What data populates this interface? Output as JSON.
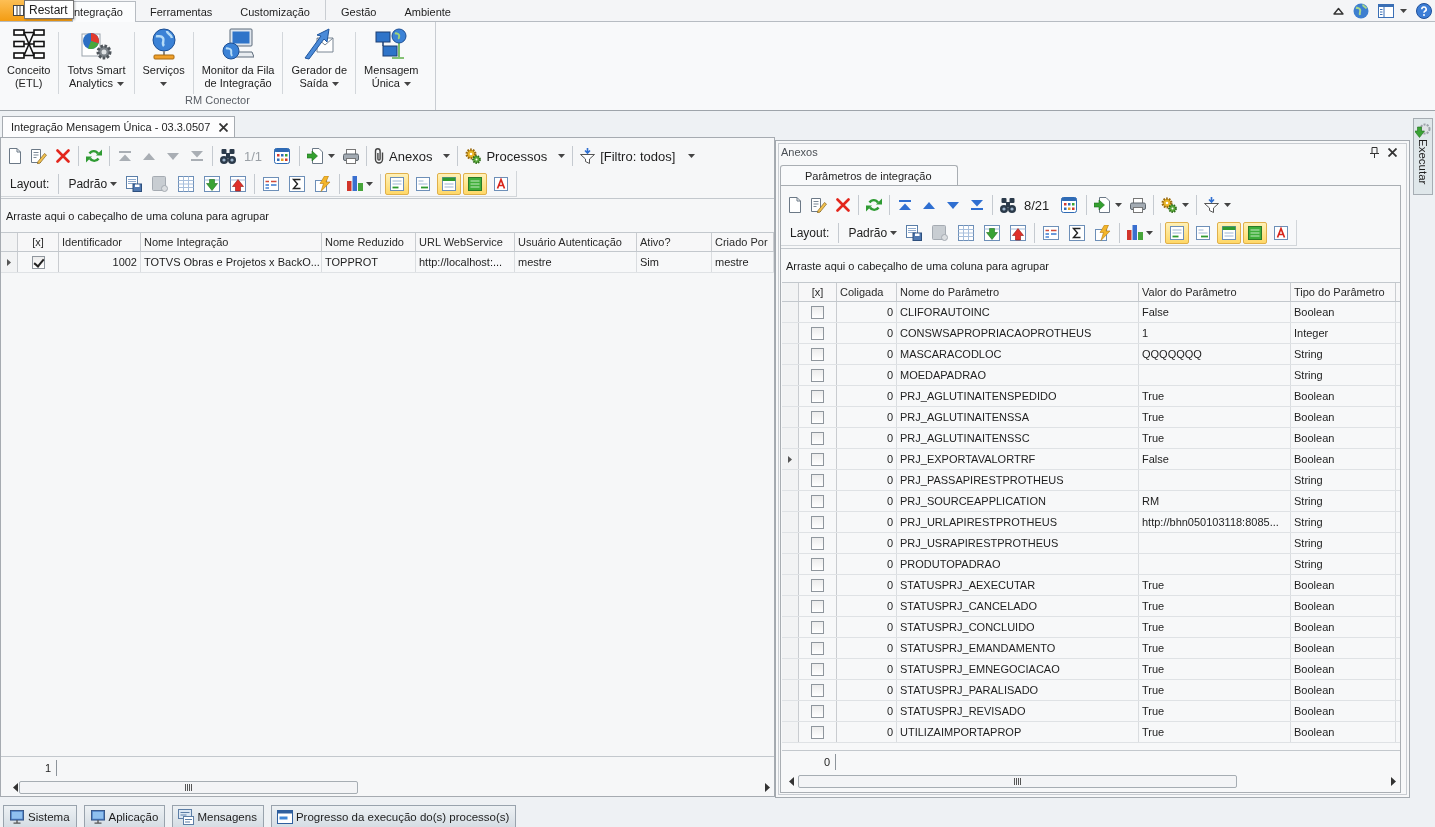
{
  "tooltip": {
    "text": "Restart"
  },
  "ribbon": {
    "tabs": [
      {
        "label": "ntegração",
        "selected": true
      },
      {
        "label": "Ferramentas",
        "selected": false
      },
      {
        "label": "Customização",
        "selected": false
      },
      {
        "label": "Gestão",
        "selected": false
      },
      {
        "label": "Ambiente",
        "selected": false
      }
    ],
    "group": {
      "label": "RM Conector",
      "buttons": [
        {
          "lines": [
            "Conceito",
            "(ETL)"
          ],
          "dropdown": false
        },
        {
          "lines": [
            "Totvs Smart",
            "Analytics"
          ],
          "dropdown": true
        },
        {
          "lines": [
            "Serviços"
          ],
          "dropdown": true
        },
        {
          "lines": [
            "Monitor da Fila",
            "de Integração"
          ],
          "dropdown": false
        },
        {
          "lines": [
            "Gerador de",
            "Saída"
          ],
          "dropdown": true
        },
        {
          "lines": [
            "Mensagem",
            "Única"
          ],
          "dropdown": true
        }
      ]
    }
  },
  "document_tab": {
    "title": "Integração Mensagem Única - 03.3.0507"
  },
  "main": {
    "toolbar": {
      "navigation_disabled": true,
      "counter": "1/1",
      "menus": [
        {
          "label": "Anexos"
        },
        {
          "label": "Processos"
        }
      ],
      "filter": "[Filtro: todos]"
    },
    "layout_bar": {
      "label": "Layout:",
      "value": "Padrão",
      "toggles": [
        {
          "selected": true
        },
        {
          "selected": false
        },
        {
          "selected": true
        },
        {
          "selected": true
        },
        {
          "selected": false
        }
      ]
    },
    "grid": {
      "group_panel": "Arraste aqui o cabeçalho de uma coluna para agrupar",
      "columns": [
        "[x]",
        "Identificador",
        "Nome Integração",
        "Nome Reduzido",
        "URL WebService",
        "Usuário Autenticação",
        "Ativo?",
        "Criado Por"
      ],
      "rows": [
        {
          "current": true,
          "checked": true,
          "identificador": "1002",
          "nome": "TOTVS Obras e Projetos x BackO...",
          "nome_reduzido": "TOPPROT",
          "url": "http://localhost:...",
          "usuario": "mestre",
          "ativo": "Sim",
          "criado_por": "mestre"
        }
      ],
      "footer": "1"
    }
  },
  "anexos": {
    "title": "Anexos",
    "tab": {
      "label": "Parâmetros de integração"
    },
    "toolbar": {
      "navigation_disabled": false,
      "counter": "8/21"
    },
    "layout_bar": {
      "label": "Layout:",
      "value": "Padrão",
      "toggles": [
        {
          "selected": true
        },
        {
          "selected": false
        },
        {
          "selected": true
        },
        {
          "selected": true
        },
        {
          "selected": false
        }
      ]
    },
    "grid": {
      "group_panel": "Arraste aqui o cabeçalho de uma coluna para agrupar",
      "columns": [
        "[x]",
        "Coligada",
        "Nome do Parâmetro",
        "Valor do Parâmetro",
        "Tipo do Parâmetro"
      ],
      "rows": [
        {
          "current": false,
          "checked": false,
          "coligada": "0",
          "parametro": "CLIFORAUTOINC",
          "valor": "False",
          "tipo": "Boolean"
        },
        {
          "current": false,
          "checked": false,
          "coligada": "0",
          "parametro": "CONSWSAPROPRIACAOPROTHEUS",
          "valor": "1",
          "tipo": "Integer"
        },
        {
          "current": false,
          "checked": false,
          "coligada": "0",
          "parametro": "MASCARACODLOC",
          "valor": "QQQQQQQ",
          "tipo": "String"
        },
        {
          "current": false,
          "checked": false,
          "coligada": "0",
          "parametro": "MOEDAPADRAO",
          "tipo": "String"
        },
        {
          "current": false,
          "checked": false,
          "coligada": "0",
          "parametro": "PRJ_AGLUTINAITENSPEDIDO",
          "valor": "True",
          "tipo": "Boolean"
        },
        {
          "current": false,
          "checked": false,
          "coligada": "0",
          "parametro": "PRJ_AGLUTINAITENSSA",
          "valor": "True",
          "tipo": "Boolean"
        },
        {
          "current": false,
          "checked": false,
          "coligada": "0",
          "parametro": "PRJ_AGLUTINAITENSSC",
          "valor": "True",
          "tipo": "Boolean"
        },
        {
          "current": true,
          "checked": false,
          "coligada": "0",
          "parametro": "PRJ_EXPORTAVALORTRF",
          "valor": "False",
          "tipo": "Boolean"
        },
        {
          "current": false,
          "checked": false,
          "coligada": "0",
          "parametro": "PRJ_PASSAPIRESTPROTHEUS",
          "tipo": "String"
        },
        {
          "current": false,
          "checked": false,
          "coligada": "0",
          "parametro": "PRJ_SOURCEAPPLICATION",
          "valor": "RM",
          "tipo": "String"
        },
        {
          "current": false,
          "checked": false,
          "coligada": "0",
          "parametro": "PRJ_URLAPIRESTPROTHEUS",
          "valor": "http://bhn050103118:8085...",
          "tipo": "String"
        },
        {
          "current": false,
          "checked": false,
          "coligada": "0",
          "parametro": "PRJ_USRAPIRESTPROTHEUS",
          "tipo": "String"
        },
        {
          "current": false,
          "checked": false,
          "coligada": "0",
          "parametro": "PRODUTOPADRAO",
          "tipo": "String"
        },
        {
          "current": false,
          "checked": false,
          "coligada": "0",
          "parametro": "STATUSPRJ_AEXECUTAR",
          "valor": "True",
          "tipo": "Boolean"
        },
        {
          "current": false,
          "checked": false,
          "coligada": "0",
          "parametro": "STATUSPRJ_CANCELADO",
          "valor": "True",
          "tipo": "Boolean"
        },
        {
          "current": false,
          "checked": false,
          "coligada": "0",
          "parametro": "STATUSPRJ_CONCLUIDO",
          "valor": "True",
          "tipo": "Boolean"
        },
        {
          "current": false,
          "checked": false,
          "coligada": "0",
          "parametro": "STATUSPRJ_EMANDAMENTO",
          "valor": "True",
          "tipo": "Boolean"
        },
        {
          "current": false,
          "checked": false,
          "coligada": "0",
          "parametro": "STATUSPRJ_EMNEGOCIACAO",
          "valor": "True",
          "tipo": "Boolean"
        },
        {
          "current": false,
          "checked": false,
          "coligada": "0",
          "parametro": "STATUSPRJ_PARALISADO",
          "valor": "True",
          "tipo": "Boolean"
        },
        {
          "current": false,
          "checked": false,
          "coligada": "0",
          "parametro": "STATUSPRJ_REVISADO",
          "valor": "True",
          "tipo": "Boolean"
        },
        {
          "current": false,
          "checked": false,
          "coligada": "0",
          "parametro": "UTILIZAIMPORTAPROP",
          "valor": "True",
          "tipo": "Boolean"
        }
      ],
      "footer": "0"
    }
  },
  "side_tab": {
    "label": "Executar"
  },
  "taskbar": {
    "buttons": [
      {
        "label": "Sistema"
      },
      {
        "label": "Aplicação"
      },
      {
        "label": "Mensagens"
      },
      {
        "label": "Progresso da execução do(s) processo(s)"
      }
    ]
  }
}
